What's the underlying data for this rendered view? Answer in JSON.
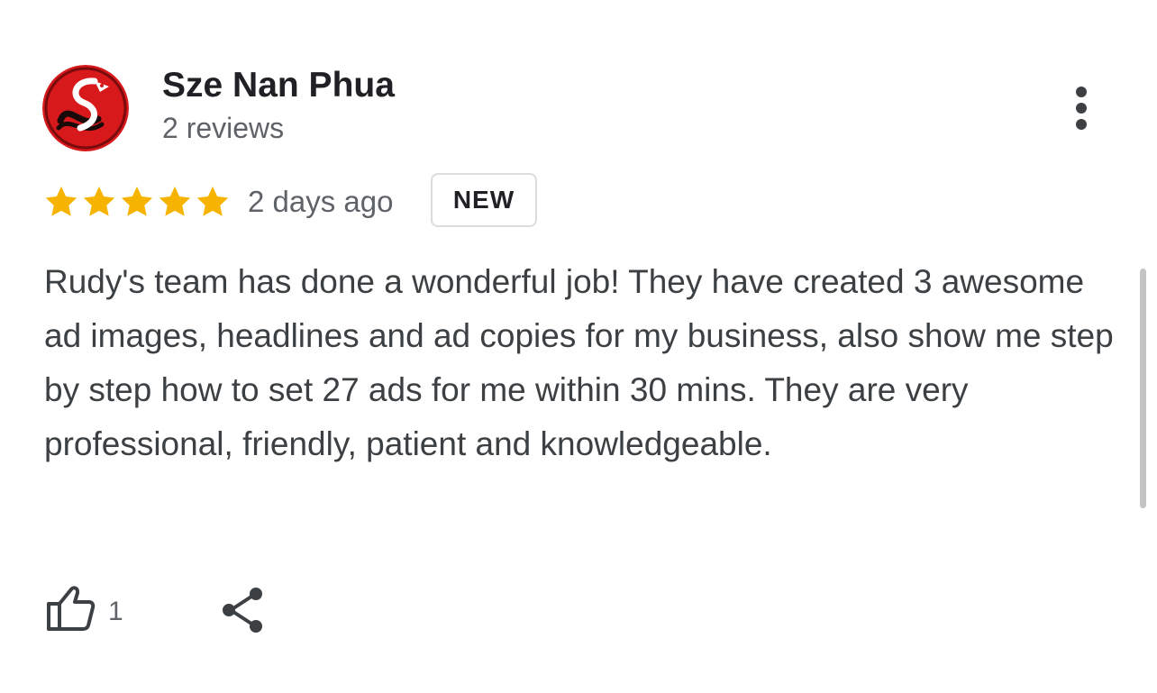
{
  "review": {
    "reviewer": {
      "name": "Sze Nan Phua",
      "review_count": "2 reviews",
      "avatar_icon": "red-dragon-logo-icon"
    },
    "rating": {
      "stars": 5,
      "max_stars": 5,
      "star_color": "#f6b400"
    },
    "date": "2 days ago",
    "badge": "NEW",
    "text": "Rudy's team has done a wonderful job! They have created 3 awesome ad images, headlines and ad copies for my business, also show me step by step how to set 27 ads for me within 30 mins. They are very professional, friendly, patient and knowledgeable.",
    "actions": {
      "like_icon": "thumbs-up-icon",
      "like_count": "1",
      "share_icon": "share-icon",
      "more_icon": "more-vert-icon"
    }
  },
  "colors": {
    "accent_red": "#d7191c",
    "text_primary": "#202124",
    "text_secondary": "#5f6368"
  }
}
